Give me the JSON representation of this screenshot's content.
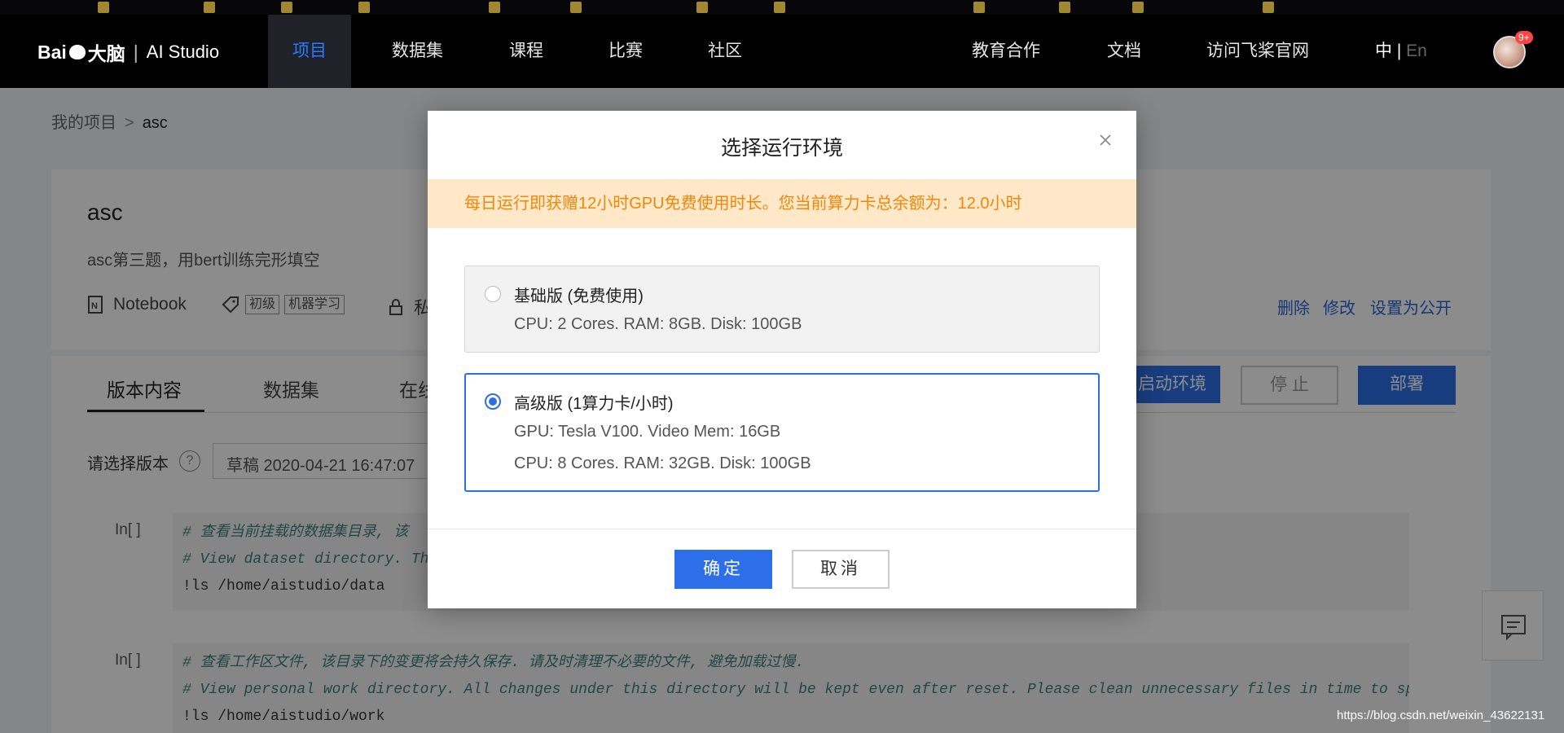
{
  "navbar": {
    "logo_brand": "Bai",
    "logo_brand2": "du",
    "logo_cn": "大脑",
    "logo_sep": "|",
    "logo_product": "AI Studio",
    "items": [
      "项目",
      "数据集",
      "课程",
      "比赛",
      "社区"
    ],
    "right_items": [
      "教育合作",
      "文档",
      "访问飞桨官网"
    ],
    "lang_cn": "中",
    "lang_sep": " | ",
    "lang_en": "En",
    "badge": "9+"
  },
  "breadcrumb": {
    "parent": "我的项目",
    "arrow": ">",
    "current": "asc"
  },
  "project": {
    "title": "asc",
    "description": "asc第三题，用bert训练完形填空",
    "type": "Notebook",
    "tags": [
      "初级",
      "机器学习"
    ],
    "visibility": "私",
    "actions": [
      "删除",
      "修改",
      "设置为公开"
    ]
  },
  "tabs": [
    "版本内容",
    "数据集",
    "在线"
  ],
  "toolbar": {
    "start_env": "启动环境",
    "stop": "停 止",
    "deploy": "部署"
  },
  "version": {
    "label": "请选择版本",
    "help": "?",
    "selected": "草稿 2020-04-21 16:47:07"
  },
  "cells": [
    {
      "prompt": "In[ ]",
      "lines": [
        "# 查看当前挂载的数据集目录, 该",
        "# View dataset directory. Thi",
        "!ls /home/aistudio/data"
      ]
    },
    {
      "prompt": "In[ ]",
      "lines": [
        "# 查看工作区文件, 该目录下的变更将会持久保存. 请及时清理不必要的文件, 避免加载过慢.",
        "# View personal work directory. All changes under this directory will be kept even after reset. Please clean unnecessary files in time to speed",
        "!ls /home/aistudio/work"
      ]
    }
  ],
  "watermark": "https://blog.csdn.net/weixin_43622131",
  "modal": {
    "title": "选择运行环境",
    "notice": "每日运行即获赠12小时GPU免费使用时长。您当前算力卡总余额为：12.0小时",
    "options": [
      {
        "title": "基础版 (免费使用)",
        "lines": [
          "CPU: 2 Cores. RAM: 8GB. Disk: 100GB"
        ],
        "selected": false
      },
      {
        "title": "高级版 (1算力卡/小时)",
        "lines": [
          "GPU: Tesla V100. Video Mem: 16GB",
          "CPU: 8 Cores. RAM: 32GB. Disk: 100GB"
        ],
        "selected": true
      }
    ],
    "ok": "确定",
    "cancel": "取消"
  }
}
